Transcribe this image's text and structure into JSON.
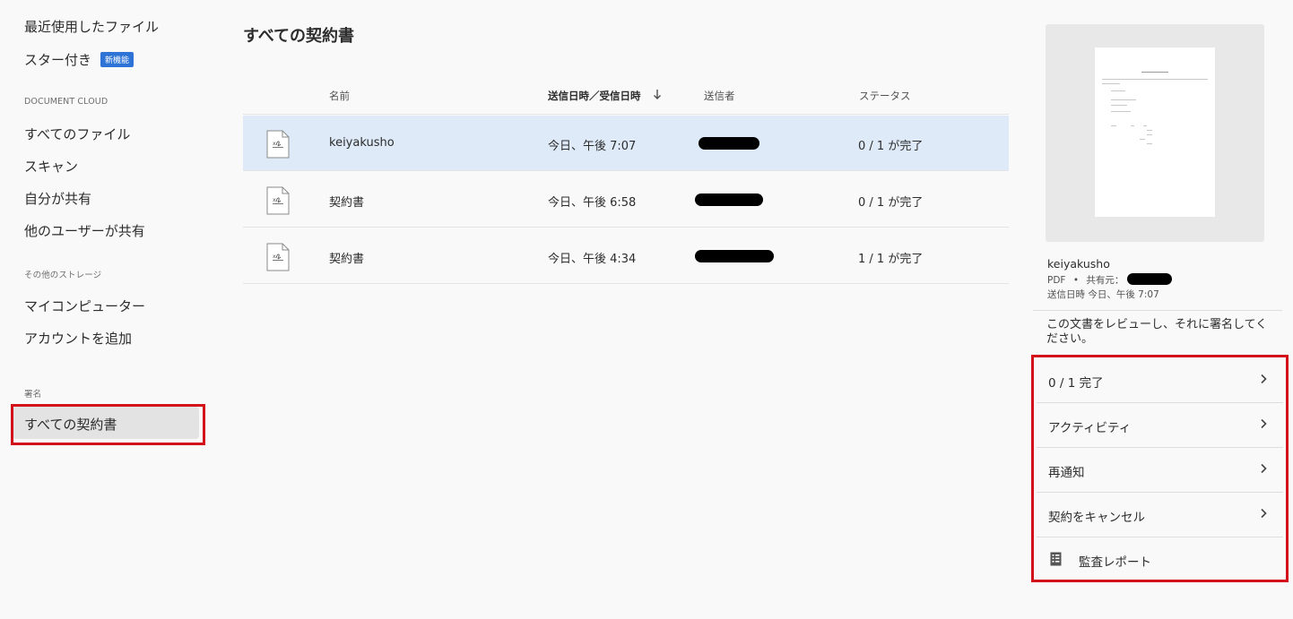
{
  "sidebar": {
    "recent": "最近使用したファイル",
    "starred": "スター付き",
    "starred_badge": "新機能",
    "section_cloud": "DOCUMENT CLOUD",
    "all_files": "すべてのファイル",
    "scan": "スキャン",
    "shared_by_me": "自分が共有",
    "shared_by_others": "他のユーザーが共有",
    "section_storage": "その他のストレージ",
    "my_computer": "マイコンピューター",
    "add_account": "アカウントを追加",
    "section_sign": "署名",
    "all_agreements": "すべての契約書"
  },
  "main": {
    "title": "すべての契約書",
    "columns": {
      "name": "名前",
      "date": "送信日時／受信日時",
      "sender": "送信者",
      "status": "ステータス"
    },
    "rows": [
      {
        "name": "keiyakusho",
        "date": "今日、午後 7:07",
        "status": "0 / 1 が完了"
      },
      {
        "name": "契約書",
        "date": "今日、午後 6:58",
        "status": "0 / 1 が完了"
      },
      {
        "name": "契約書",
        "date": "今日、午後 4:34",
        "status": "1 / 1 が完了"
      }
    ]
  },
  "panel": {
    "file_name": "keiyakusho",
    "file_type": "PDF",
    "shared_from": "共有元：",
    "sent_date": "送信日時 今日、午後 7:07",
    "review_text": "この文書をレビューし、それに署名してください。",
    "actions": {
      "progress": "0 / 1 完了",
      "activity": "アクティビティ",
      "remind": "再通知",
      "cancel": "契約をキャンセル",
      "audit": "監査レポート"
    }
  },
  "colors": {
    "selected_row": "#deeaf8",
    "badge": "#2d74d6",
    "highlight_border": "#d2111b"
  }
}
